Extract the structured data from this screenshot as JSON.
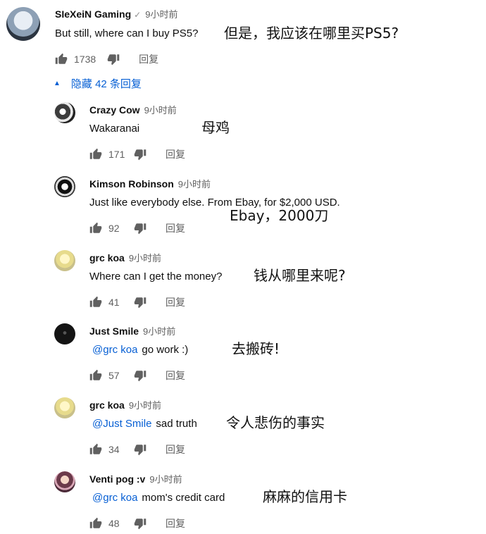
{
  "comment": {
    "author": "SIeXeiN Gaming",
    "verified_mark": "✓",
    "time": "9小时前",
    "text": "But still, where can I buy PS5?",
    "overlay": "但是，我应该在哪里买PS5?",
    "likes": "1738",
    "reply_label": "回复"
  },
  "replies_toggle": {
    "label": "隐藏 42 条回复"
  },
  "replies": [
    {
      "author": "Crazy Cow",
      "time": "9小时前",
      "mention": "",
      "text": "Wakaranai",
      "overlay": "母鸡",
      "likes": "171",
      "reply_label": "回复"
    },
    {
      "author": "Kimson Robinson",
      "time": "9小时前",
      "mention": "",
      "text": "Just like everybody else. From Ebay, for $2,000 USD.",
      "overlay": "Ebay，2000刀",
      "likes": "92",
      "reply_label": "回复"
    },
    {
      "author": "grc koa",
      "time": "9小时前",
      "mention": "",
      "text": "Where can I get the money?",
      "overlay": "钱从哪里来呢?",
      "likes": "41",
      "reply_label": "回复"
    },
    {
      "author": "Just Smile",
      "time": "9小时前",
      "mention": "@grc koa",
      "text": "go work :)",
      "overlay": "去搬砖!",
      "likes": "57",
      "reply_label": "回复"
    },
    {
      "author": "grc koa",
      "time": "9小时前",
      "mention": "@Just Smile",
      "text": "sad truth",
      "overlay": "令人悲伤的事实",
      "likes": "34",
      "reply_label": "回复"
    },
    {
      "author": "Venti pog :v",
      "time": "9小时前",
      "mention": "@grc koa",
      "text": "mom's credit card",
      "overlay": "麻麻的信用卡",
      "likes": "48",
      "reply_label": "回复"
    }
  ]
}
